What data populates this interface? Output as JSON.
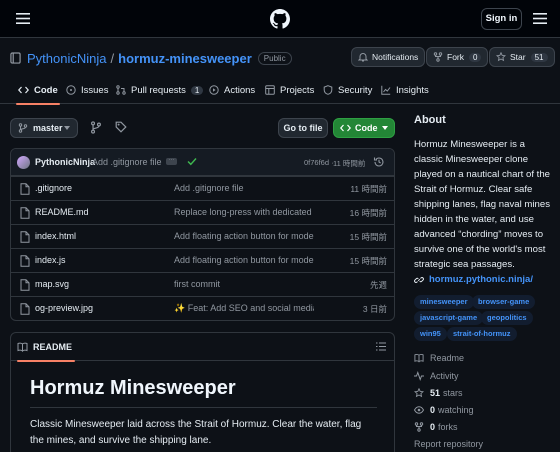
{
  "header": {
    "menu_icon": "hamburger-icon",
    "logo_icon": "github-logo-icon",
    "signin_label": "Sign in"
  },
  "repo": {
    "owner": "PythonicNinja",
    "separator": "/",
    "name": "hormuz-minesweeper",
    "visibility": "Public",
    "notifications_label": "Notifications",
    "fork_label": "Fork",
    "fork_count": "0",
    "star_label": "Star",
    "star_count": "51"
  },
  "tabs": [
    {
      "label": "Code",
      "icon": "code-icon",
      "active": true
    },
    {
      "label": "Issues",
      "icon": "issue-icon"
    },
    {
      "label": "Pull requests",
      "icon": "pull-request-icon",
      "count": "1"
    },
    {
      "label": "Actions",
      "icon": "play-icon"
    },
    {
      "label": "Projects",
      "icon": "table-icon"
    },
    {
      "label": "Security",
      "icon": "shield-icon"
    },
    {
      "label": "Insights",
      "icon": "graph-icon"
    }
  ],
  "branch": {
    "name": "master",
    "goto_label": "Go to file",
    "code_label": "Code"
  },
  "commit": {
    "author": "PythonicNinja",
    "message": "Add .gitignore file",
    "dots": "···",
    "hash": "0f76f6d",
    "separator": "·",
    "time": "11 時間前"
  },
  "files": [
    {
      "type": "file",
      "name": ".gitignore",
      "message": "Add .gitignore file",
      "time": "11 時間前"
    },
    {
      "type": "file",
      "name": "README.md",
      "message": "Replace long-press with dedicated fl...",
      "time": "16 時間前"
    },
    {
      "type": "file",
      "name": "index.html",
      "message": "Add floating action button for mode ...",
      "time": "15 時間前"
    },
    {
      "type": "file",
      "name": "index.js",
      "message": "Add floating action button for mode ...",
      "time": "15 時間前"
    },
    {
      "type": "file",
      "name": "map.svg",
      "message": "first commit",
      "time": "先週"
    },
    {
      "type": "file",
      "name": "og-preview.jpg",
      "message": "✨ Feat: Add SEO and social media ...",
      "time": "3 日前"
    }
  ],
  "readme": {
    "tab_label": "README",
    "title": "Hormuz Minesweeper",
    "text": "Classic Minesweeper laid across the Strait of Hormuz. Clear the water, flag the mines, and survive the shipping lane."
  },
  "about": {
    "heading": "About",
    "description": "Hormuz Minesweeper is a classic Minesweeper clone played on a nautical chart of the Strait of Hormuz. Clear safe shipping lanes, flag naval mines hidden in the water, and use advanced “chording” moves to survive one of the world's most strategic sea passages.",
    "website": "hormuz.pythonic.ninja/",
    "topics": [
      "minesweeper",
      "browser-game",
      "javascript-game",
      "geopolitics",
      "win95",
      "strait-of-hormuz"
    ],
    "readme_label": "Readme",
    "activity_label": "Activity",
    "stars_count": "51",
    "stars_label": "stars",
    "watching_count": "0",
    "watching_label": "watching",
    "forks_count": "0",
    "forks_label": "forks",
    "report_label": "Report repository"
  },
  "colors": {
    "background": "#0d1117",
    "link": "#4493f8",
    "code_button": "#238636",
    "active_tab_underline": "#f78166"
  }
}
